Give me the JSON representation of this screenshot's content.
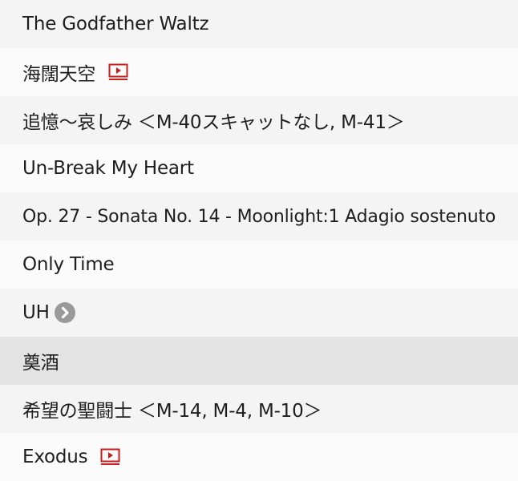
{
  "tracks": [
    {
      "title": "The Godfather Waltz"
    },
    {
      "title": "海闊天空",
      "icon": "mv-icon"
    },
    {
      "title": "追憶～哀しみ ＜M-40スキャットなし, M-41＞"
    },
    {
      "title": "Un-Break My Heart"
    },
    {
      "title": "Op. 27 - Sonata No. 14 - Moonlight:1 Adagio sostenuto"
    },
    {
      "title": "Only Time"
    },
    {
      "title": "UH",
      "icon": "chevron-right-icon"
    },
    {
      "title": "奠酒",
      "selected": true
    },
    {
      "title": "希望の聖闘士 ＜M-14, M-4, M-10＞"
    },
    {
      "title": "Exodus",
      "icon": "mv-icon"
    }
  ],
  "colors": {
    "row_odd": "#f4f4f4",
    "row_even": "#fbfbfb",
    "row_selected": "#e3e3e3",
    "mv_icon": "#c81e1e",
    "chevron_badge": "#9a9a9a"
  }
}
